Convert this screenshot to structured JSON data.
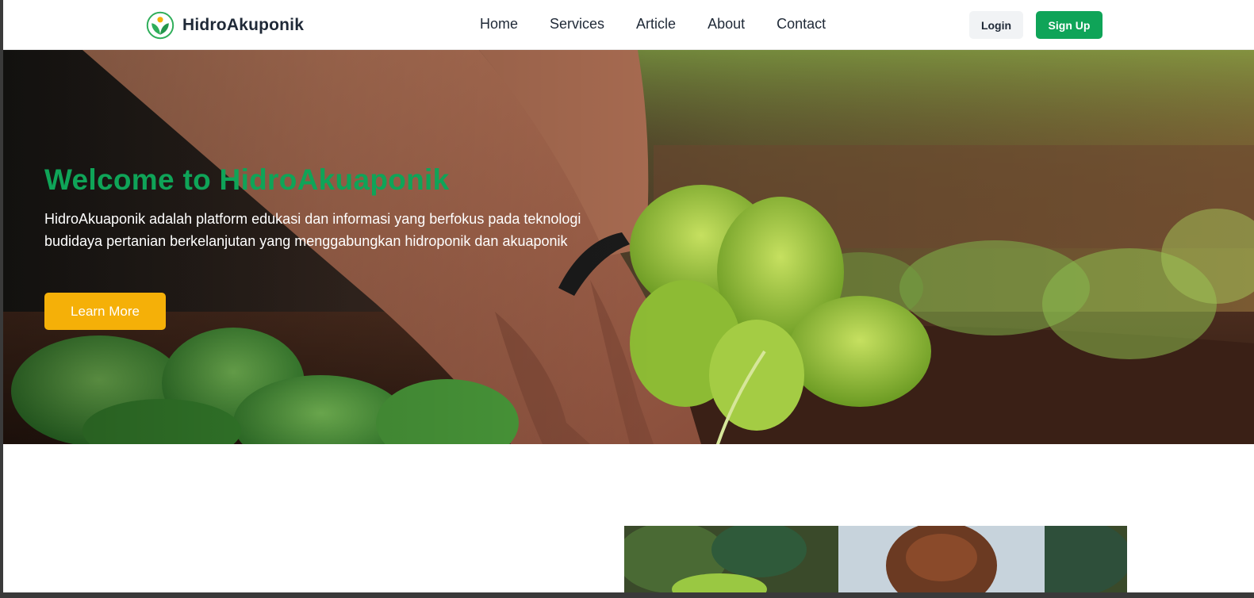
{
  "brand": {
    "name": "HidroAkuponik",
    "logo_icon": "leaf-logo-icon"
  },
  "nav": {
    "links": [
      "Home",
      "Services",
      "Article",
      "About",
      "Contact"
    ],
    "login_label": "Login",
    "signup_label": "Sign Up"
  },
  "hero": {
    "title": "Welcome to HidroAkuaponik",
    "description": "HidroAkuaponik adalah platform edukasi dan informasi yang berfokus pada teknologi budidaya pertanian berkelanjutan yang menggabungkan hidroponik dan akuaponik",
    "cta_label": "Learn More",
    "image": "hand-planting-lettuce-photo"
  },
  "section2": {
    "image": "person-gardening-photo"
  },
  "colors": {
    "brand_green": "#0fa458",
    "cta_yellow": "#f5b008",
    "text_dark": "#1f2937",
    "login_bg": "#f1f3f5"
  }
}
